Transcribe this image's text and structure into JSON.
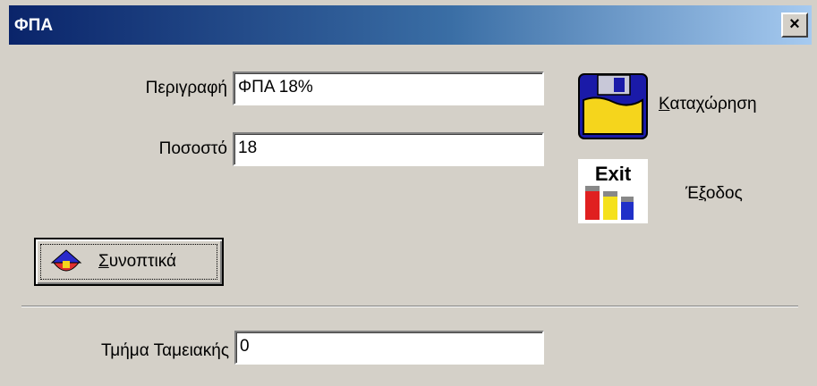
{
  "window": {
    "title": "ΦΠΑ",
    "close_label": "×"
  },
  "form": {
    "description_label": "Περιγραφή",
    "description_value": "ΦΠΑ 18%",
    "percent_label": "Ποσοστό",
    "percent_value": "18",
    "register_label": "Τμήμα Ταμειακής",
    "register_value": "0"
  },
  "buttons": {
    "save_label_first": "Κ",
    "save_label_rest": "αταχώρηση",
    "save_icon": "floppy-disk-icon",
    "exit_label_pre": "Έ",
    "exit_label_u": "ξ",
    "exit_label_rest": "οδος",
    "exit_icon_text": "Exit",
    "exit_icon": "exit-icon",
    "summary_label_first": "Σ",
    "summary_label_rest": "υνοπτικά",
    "summary_icon": "arrow-up-icon"
  },
  "colors": {
    "titlebar_start": "#0a246a",
    "titlebar_end": "#a6caf0",
    "window_bg": "#d4d0c8"
  }
}
